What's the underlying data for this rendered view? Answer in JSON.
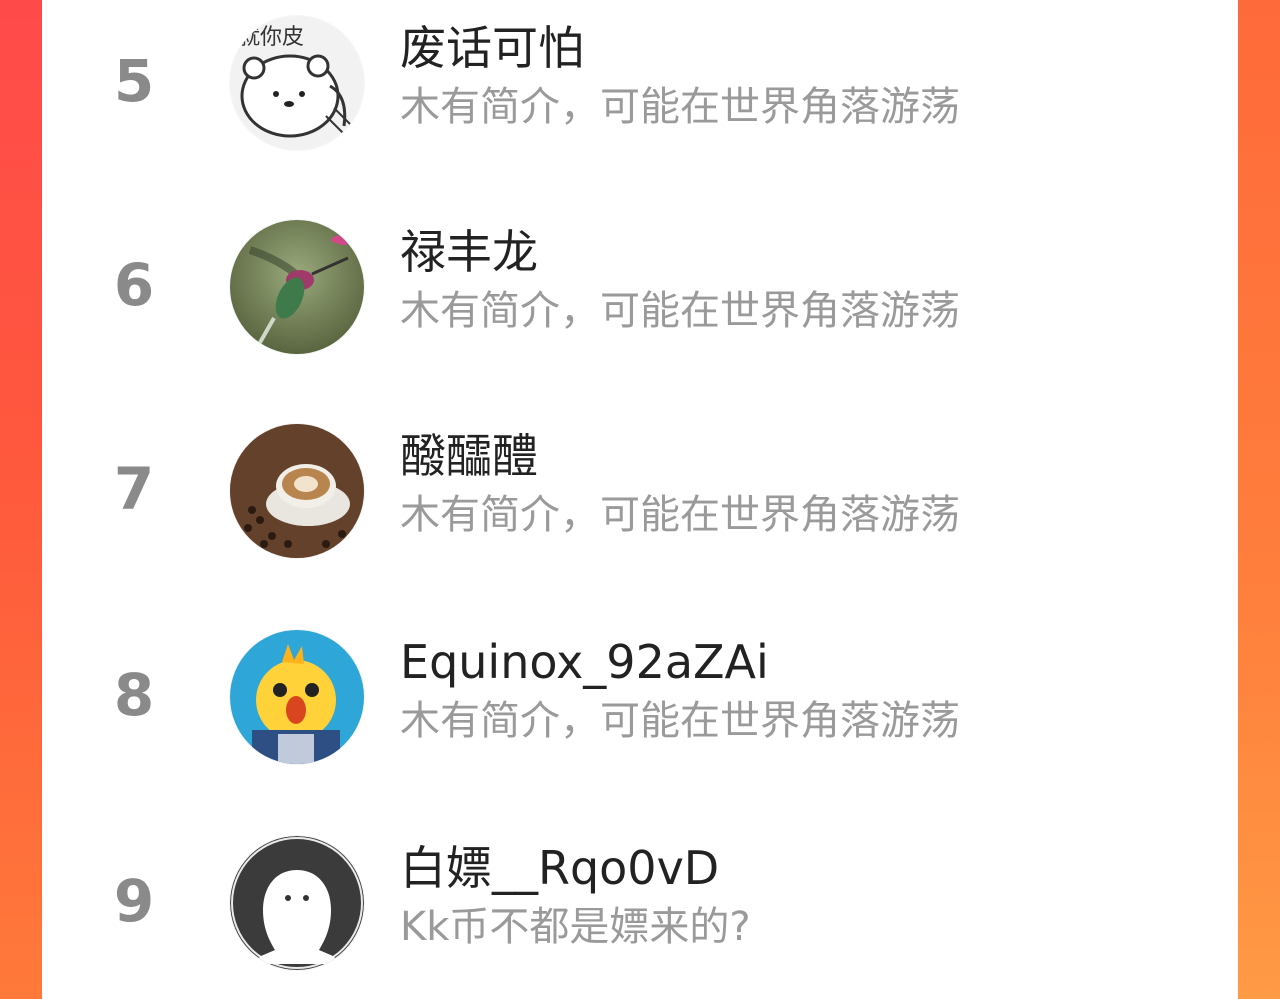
{
  "colors": {
    "background_left": "#ff4a4a",
    "background_right": "#ff7f3c",
    "panel": "#ffffff",
    "rank": "#8a8a8a",
    "name": "#222222",
    "bio": "#9a9a9a"
  },
  "ranking": {
    "items": [
      {
        "rank": "5",
        "name": "废话可怕",
        "bio": "木有简介，可能在世界角落游荡",
        "avatar_icon": "cartoon-bear-sketch-avatar",
        "avatar_text": "就你皮"
      },
      {
        "rank": "6",
        "name": "禄丰龙",
        "bio": "木有简介，可能在世界角落游荡",
        "avatar_icon": "hummingbird-photo-avatar"
      },
      {
        "rank": "7",
        "name": "醱醽醴",
        "bio": "木有简介，可能在世界角落游荡",
        "avatar_icon": "coffee-cup-photo-avatar"
      },
      {
        "rank": "8",
        "name": "Equinox_92aZAi",
        "bio": "木有简介，可能在世界角落游荡",
        "avatar_icon": "yellow-chick-avatar"
      },
      {
        "rank": "9",
        "name": "白嫖__Rqo0vD",
        "bio": "Kk币不都是嫖来的?",
        "avatar_icon": "default-ghost-avatar"
      }
    ]
  }
}
